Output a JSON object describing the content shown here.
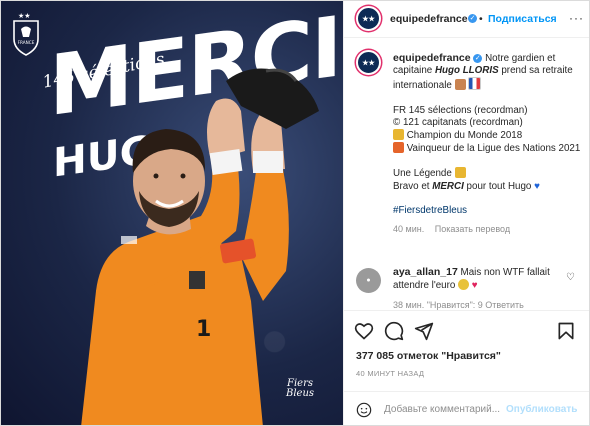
{
  "post": {
    "image": {
      "selections_text": "145 sélections",
      "merci_text": "MERCI",
      "hugo_text": "HUGO",
      "logo_text": "FRANCE",
      "watermark_line1": "Fiers",
      "watermark_line2": "Bleus"
    },
    "header": {
      "username": "equipedefrance",
      "separator": "•",
      "follow_label": "Подписаться",
      "more_label": "···"
    },
    "caption": {
      "username": "equipedefrance",
      "line1": "Notre gardien et capitaine",
      "name": "Hugo LLORIS",
      "line1_end": "prend sa retraite internationale",
      "stat1": "FR 145 sélections (recordman)",
      "stat2": "© 121 capitanats (recordman)",
      "stat3": "Champion du Monde 2018",
      "stat4": "Vainqueur de la Ligue des Nations 2021",
      "legend": "Une Légende",
      "bravo_prefix": "Bravo et",
      "bravo_bold": "MERCI",
      "bravo_suffix": "pour tout Hugo",
      "hashtag": "#FiersdetreBleus",
      "time": "40 мин.",
      "translate": "Показать перевод"
    },
    "comment": {
      "username": "aya_allan_17",
      "text": "Mais non WTF fallait attendre l'euro",
      "meta": "38 мин.  \"Нравится\": 9  Ответить"
    },
    "likes": "377 085 отметок \"Нравится\"",
    "time_ago": "40 МИНУТ НАЗАД",
    "add_comment": {
      "placeholder": "Добавьте комментарий...",
      "publish_label": "Опубликовать"
    },
    "colors": {
      "accent": "#0095f6",
      "verified": "#3897f0",
      "jersey": "#f08a1f"
    }
  }
}
